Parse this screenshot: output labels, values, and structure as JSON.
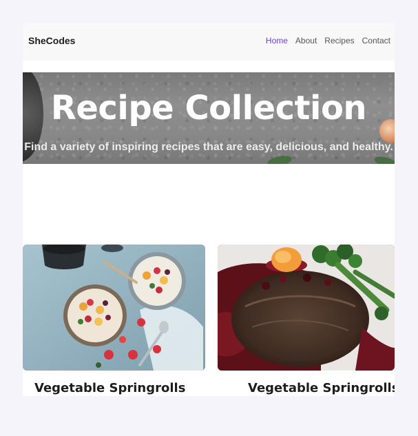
{
  "navbar": {
    "brand": "SheCodes",
    "links": [
      {
        "label": "Home",
        "active": true
      },
      {
        "label": "About",
        "active": false
      },
      {
        "label": "Recipes",
        "active": false
      },
      {
        "label": "Contact",
        "active": false
      }
    ]
  },
  "hero": {
    "title": "Recipe Collection",
    "subtitle": "Find a variety of inspiring recipes that are easy, delicious, and healthy."
  },
  "cards": [
    {
      "title": "Vegetable Springrolls",
      "image": "breakfast-bowls-photo"
    },
    {
      "title": "Vegetable Springrolls",
      "image": "steak-dinner-photo"
    }
  ],
  "colors": {
    "page_background": "#f6f4fb",
    "navbar_background": "#f8f8f9",
    "active_link": "#6b3fd6",
    "text": "#1d1d1f"
  }
}
